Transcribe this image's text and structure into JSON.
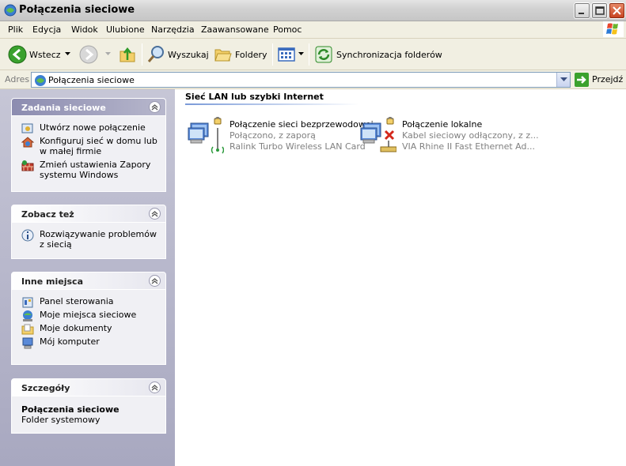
{
  "window": {
    "title": "Połączenia sieciowe"
  },
  "menu": {
    "items": [
      "Plik",
      "Edycja",
      "Widok",
      "Ulubione",
      "Narzędzia",
      "Zaawansowane",
      "Pomoc"
    ]
  },
  "toolbar": {
    "back_label": "Wstecz",
    "search_label": "Wyszukaj",
    "folders_label": "Foldery",
    "sync_label": "Synchronizacja folderów"
  },
  "address": {
    "label": "Adres",
    "value": "Połączenia sieciowe",
    "go_label": "Przejdź"
  },
  "sidebar": {
    "network_tasks": {
      "title": "Zadania sieciowe",
      "items": [
        "Utwórz nowe połączenie",
        "Konfiguruj sieć w domu lub w małej firmie",
        "Zmień ustawienia Zapory systemu Windows"
      ]
    },
    "see_also": {
      "title": "Zobacz też",
      "items": [
        "Rozwiązywanie problemów z siecią"
      ]
    },
    "other_places": {
      "title": "Inne miejsca",
      "items": [
        "Panel sterowania",
        "Moje miejsca sieciowe",
        "Moje dokumenty",
        "Mój komputer"
      ]
    },
    "details": {
      "title": "Szczegóły",
      "name": "Połączenia sieciowe",
      "type": "Folder systemowy"
    }
  },
  "main": {
    "group_title": "Sieć LAN lub szybki Internet",
    "connections": [
      {
        "name": "Połączenie sieci bezprzewodowej",
        "status": "Połączono, z zaporą",
        "device": "Ralink Turbo Wireless LAN Card"
      },
      {
        "name": "Połączenie lokalne",
        "status": "Kabel sieciowy odłączony, z z...",
        "device": "VIA Rhine II Fast Ethernet Ad..."
      }
    ]
  },
  "colors": {
    "sidebar_top": "#c6c6d6",
    "sidebar_bottom": "#a8a8c0",
    "toolbar_bg": "#f1efe2",
    "accent": "#4a70c8"
  }
}
